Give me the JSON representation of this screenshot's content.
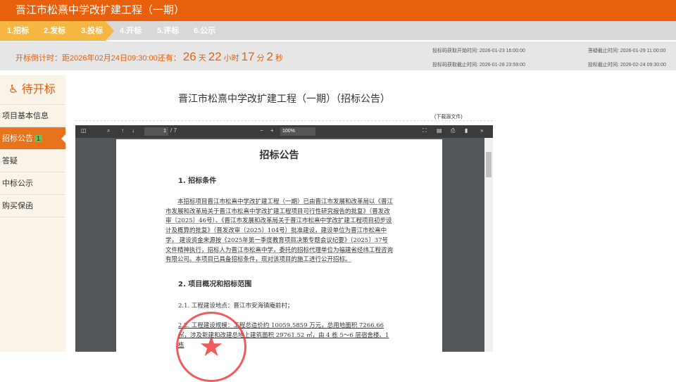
{
  "header": {
    "title": "晋江市松熹中学改扩建工程（一期）"
  },
  "steps": [
    "1.招标",
    "2.发标",
    "3.投标",
    "4.开标",
    "5.评标",
    "6.公示"
  ],
  "countdown": {
    "prefix": "开标倒计时：距2026年02月24日09:30:00还有：",
    "days": "26",
    "days_unit": "天",
    "hours": "22",
    "hours_unit": "小时",
    "minutes": "17",
    "minutes_unit": "分",
    "seconds": "2",
    "seconds_unit": "秒"
  },
  "times": {
    "code_start_label": "投标码获取开始时间:",
    "code_start": "2026-01-23 16:00:00",
    "code_end_label": "投标码获取截止时间:",
    "code_end": "2026-01-28 23:59:00",
    "qa_end_label": "答疑截止时间:",
    "qa_end": "2026-01-29 11:00:00",
    "bid_end_label": "投标截止时间:",
    "bid_end": "2026-02-24 09:30:00"
  },
  "sidebar": {
    "status": "待开标",
    "items": [
      {
        "label": "项目基本信息"
      },
      {
        "label": "招标公告",
        "badge": "1"
      },
      {
        "label": "答疑"
      },
      {
        "label": "中标公示"
      },
      {
        "label": "购买保函"
      }
    ]
  },
  "main": {
    "title": "晋江市松熹中学改扩建工程（一期）（招标公告）",
    "download": "(下载源文件)"
  },
  "pdf": {
    "page": "1",
    "total": "/ 7",
    "zoom": "100%",
    "doc_title": "招标公告",
    "s1": "1. 招标条件",
    "p1": "本招标项目晋江市松熹中学改扩建工程（一期）已由晋江市发展和改革局以《晋江市发展和改革局关于晋江市松熹中学改扩建工程项目可行性研究报告的批复》（晋发改审〔2025〕46号）、《晋江市发展和改革局关于晋江市松熹中学改扩建工程项目初步设计及概算的批复》（晋发改审〔2025〕104号）批准建设，建设单位为晋江市松熹中学， 建设资金来源按《2025年第一季度教育项目决策专题会议纪要》〔2025〕37号文件精神执行，招标人为晋江市松熹中学，委托的招标代理单位为福建省经纬工程咨询有限公司。本项目已具备招标条件，现对该项目的施工进行公开招标。",
    "s2": "2. 项目概况和招标范围",
    "p21": "2.1. 工程建设地点：晋江市安海镇庵前村；",
    "p22": "2.2. 工程建设规模：工程总造价约 10059.5859 万元，总用地面积 7266.66 ㎡，涉及新建和改建总地上建筑面积 29761.52 ㎡，由 4 栋 5～6 层宿舍楼、1 栋"
  }
}
